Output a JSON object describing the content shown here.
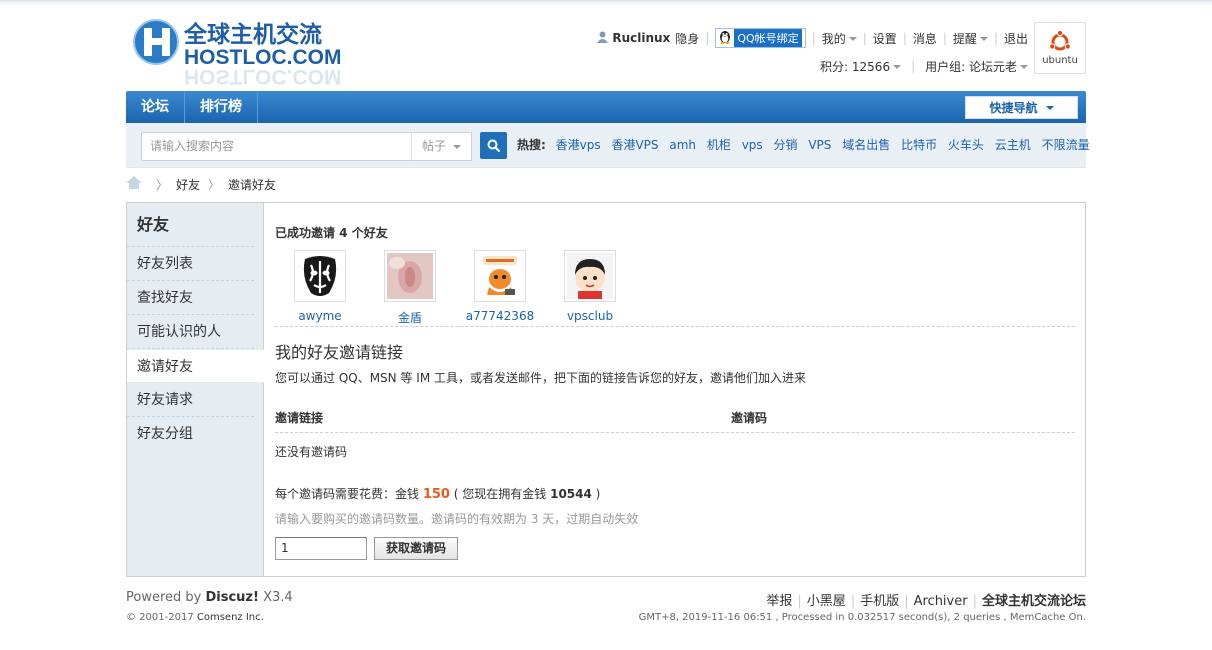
{
  "header": {
    "logo_title": "全球主机交流",
    "logo_domain": "HOSTLOC.COM",
    "username": "Ruclinux",
    "invisible": "隐身",
    "qq_bind": "QQ帐号绑定",
    "my": "我的",
    "settings": "设置",
    "messages": "消息",
    "reminders": "提醒",
    "logout": "退出",
    "points": "积分: 12566",
    "usergroup": "用户组: 论坛元老",
    "avatar_label": "ubuntu"
  },
  "nav": {
    "items": [
      "论坛",
      "排行榜"
    ],
    "quick_nav": "快捷导航"
  },
  "search": {
    "placeholder": "请输入搜索内容",
    "scope": "帖子",
    "hot_label": "热搜:",
    "hot_terms": [
      "香港vps",
      "香港VPS",
      "amh",
      "机柜",
      "vps",
      "分销",
      "VPS",
      "域名出售",
      "比特币",
      "火车头",
      "云主机",
      "不限流量"
    ]
  },
  "breadcrumb": {
    "items": [
      "好友",
      "邀请好友"
    ]
  },
  "sidebar": {
    "title": "好友",
    "items": [
      "好友列表",
      "查找好友",
      "可能认识的人",
      "邀请好友",
      "好友请求",
      "好友分组"
    ]
  },
  "main": {
    "invited_heading": "已成功邀请 4 个好友",
    "friends": [
      "awyme",
      "金盾",
      "a77742368",
      "vpsclub"
    ],
    "link_heading": "我的好友邀请链接",
    "link_desc": "您可以通过 QQ、MSN 等 IM 工具，或者发送邮件，把下面的链接告诉您的好友，邀请他们加入进来",
    "col_link": "邀请链接",
    "col_code": "邀请码",
    "empty": "还没有邀请码",
    "cost_prefix": "每个邀请码需要花费：金钱 ",
    "cost_value": "150",
    "cost_mid": " ( 您现在拥有金钱 ",
    "balance": "10544",
    "cost_suffix": " )",
    "tip": "请输入要购买的邀请码数量。邀请码的有效期为 3 天，过期自动失效",
    "qty_value": "1",
    "get_button": "获取邀请码"
  },
  "footer": {
    "powered_prefix": "Powered by ",
    "powered_name": "Discuz!",
    "powered_version": " X3.4",
    "copyright_prefix": "© 2001-2017 ",
    "copyright_company": "Comsenz Inc.",
    "links": [
      "举报",
      "小黑屋",
      "手机版",
      "Archiver"
    ],
    "site_name": "全球主机交流论坛",
    "stats": "GMT+8, 2019-11-16 06:51 , Processed in 0.032517 second(s), 2 queries , MemCache On."
  },
  "colors": {
    "nav_blue": "#1b64ad",
    "link_blue": "#1b64ad",
    "price_orange": "#e55b1f",
    "sidebar_bg": "#e5edf2"
  }
}
